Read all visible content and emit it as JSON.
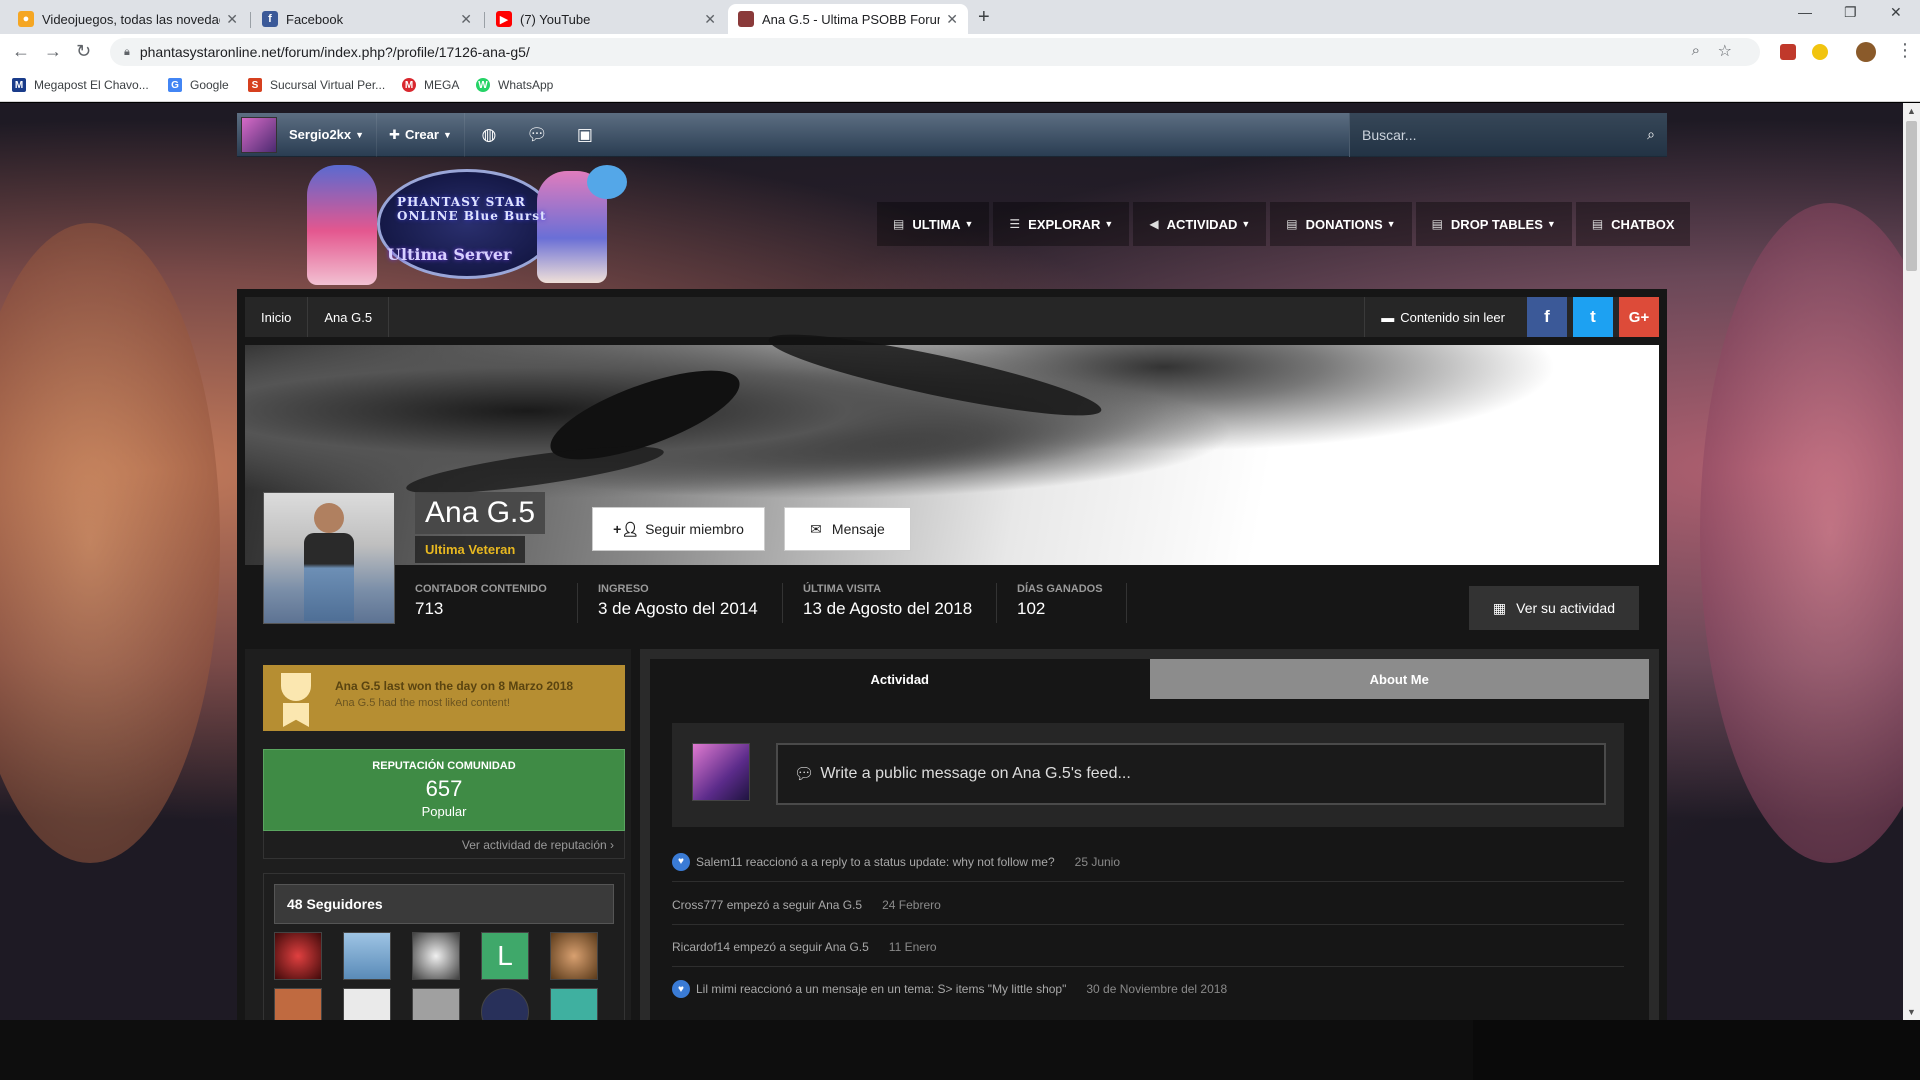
{
  "browser": {
    "tabs": [
      {
        "label": "Videojuegos, todas las novedades",
        "icon": "game-favicon",
        "color": "#f5a623"
      },
      {
        "label": "Facebook",
        "icon": "facebook-favicon",
        "color": "#3b5998"
      },
      {
        "label": "(7) YouTube",
        "icon": "youtube-favicon",
        "color": "#ff0000"
      },
      {
        "label": "Ana G.5 - Ultima PSOBB Forum",
        "icon": "pso-favicon",
        "color": "#8a3a3a",
        "active": true
      }
    ],
    "url": "phantasystaronline.net/forum/index.php?/profile/17126-ana-g5/",
    "bookmarks": [
      {
        "label": "Megapost El Chavo...",
        "color": "#1a3c8a",
        "glyph": "M"
      },
      {
        "label": "Google",
        "color": "#4285f4",
        "glyph": "G"
      },
      {
        "label": "Sucursal Virtual Per...",
        "color": "#d6401f",
        "glyph": "S"
      },
      {
        "label": "MEGA",
        "color": "#d9272e",
        "glyph": "M"
      },
      {
        "label": "WhatsApp",
        "color": "#25d366",
        "glyph": "W"
      }
    ]
  },
  "site": {
    "user": "Sergio2kx",
    "create": "Crear",
    "search_placeholder": "Buscar...",
    "logo_line1": "PHANTASY STAR ONLINE Blue Burst",
    "logo_line2": "Ultima Server",
    "nav": [
      "ULTIMA",
      "EXPLORAR",
      "ACTIVIDAD",
      "DONATIONS",
      "DROP TABLES",
      "CHATBOX"
    ]
  },
  "breadcrumb": [
    "Inicio",
    "Ana G.5"
  ],
  "unread_label": "Contenido sin leer",
  "share": [
    "f",
    "t",
    "G+"
  ],
  "profile": {
    "name": "Ana G.5",
    "rank": "Ultima Veteran",
    "follow_label": "Seguir miembro",
    "message_label": "Mensaje",
    "activity_label": "Ver su actividad",
    "stats": [
      {
        "label": "CONTADOR CONTENIDO",
        "value": "713"
      },
      {
        "label": "INGRESO",
        "value": "3 de Agosto del 2014"
      },
      {
        "label": "ÚLTIMA VISITA",
        "value": "13 de Agosto del 2018"
      },
      {
        "label": "DÍAS GANADOS",
        "value": "102"
      }
    ]
  },
  "day_win": {
    "line1": "Ana G.5 last won the day on 8 Marzo 2018",
    "line2": "Ana G.5 had the most liked content!"
  },
  "reputation": {
    "title": "REPUTACIÓN COMUNIDAD",
    "value": "657",
    "level": "Popular",
    "link": "Ver actividad de reputación ›"
  },
  "followers": {
    "title": "48 Seguidores",
    "avatars": [
      {
        "color": "#b22a2a"
      },
      {
        "color": "#5a8bb8"
      },
      {
        "color": "#c8c8c8"
      },
      {
        "color": "#3fa86a",
        "letter": "L"
      },
      {
        "color": "#7a5a3a"
      },
      {
        "color": "#c06a40"
      },
      {
        "color": "#eaeaea"
      },
      {
        "color": "#a0a0a0"
      },
      {
        "color": "#28305a"
      },
      {
        "color": "#3fb0a0"
      }
    ]
  },
  "tabs": {
    "activity": "Actividad",
    "about": "About Me"
  },
  "composer_placeholder": "Write a public message on Ana G.5's feed...",
  "feed": [
    {
      "text": "Salem11 reaccionó a a reply to a status update: why not follow me?",
      "when": "25 Junio",
      "heart": true
    },
    {
      "text": "Cross777 empezó a seguir Ana G.5",
      "when": "24 Febrero",
      "heart": false
    },
    {
      "text": "Ricardof14 empezó a seguir Ana G.5",
      "when": "11 Enero",
      "heart": false
    },
    {
      "text": "Lil mimi reaccionó a un mensaje en un tema: S> items \"My little shop\"",
      "when": "30 de Noviembre del 2018",
      "heart": true
    }
  ]
}
